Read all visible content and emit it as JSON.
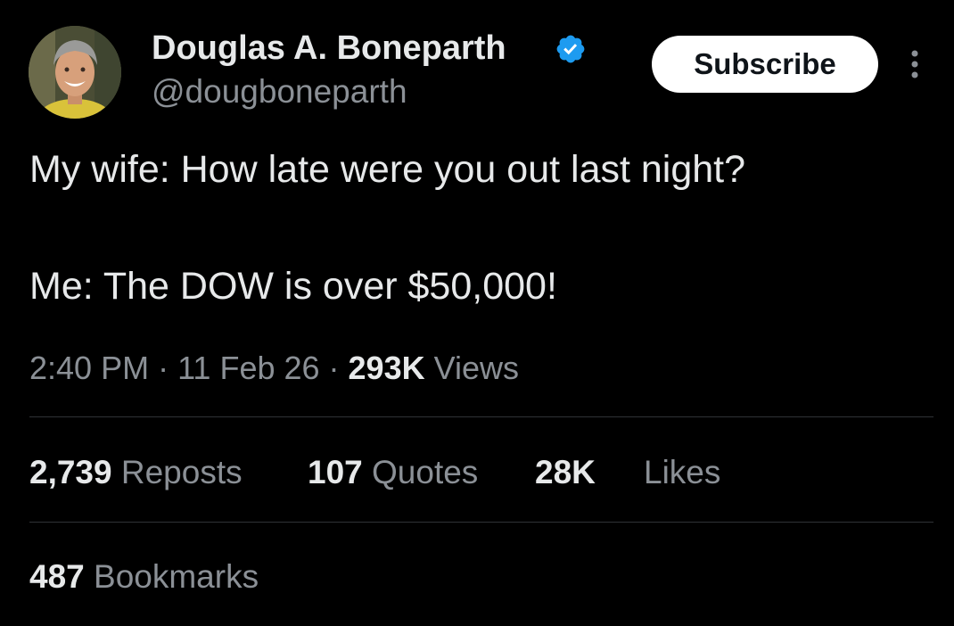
{
  "author": {
    "display_name": "Douglas A. Boneparth",
    "handle": "@dougboneparth",
    "verified_icon": "verified-badge-icon",
    "avatar_icon": "profile-photo"
  },
  "subscribe_label": "Subscribe",
  "more_icon": "more-vertical-icon",
  "tweet": {
    "line1": "My wife: How late were you out last night?",
    "line2": "Me: The DOW is over $50,000!"
  },
  "meta": {
    "time": "2:40 PM",
    "sep1": " · ",
    "date": "11 Feb 26",
    "sep2": " · ",
    "views_count": "293K",
    "views_label": " Views"
  },
  "stats": {
    "reposts_count": "2,739",
    "reposts_label": " Reposts",
    "quotes_count": "107",
    "quotes_label": " Quotes",
    "likes_count": "28K",
    "likes_label": "Likes",
    "bookmarks_count": "487",
    "bookmarks_label": " Bookmarks"
  },
  "colors": {
    "background": "#000000",
    "primary_text": "#e7e9ea",
    "secondary_text": "#8b9096",
    "verified_blue": "#1d9bf0",
    "divider": "#2f3336",
    "button_bg": "#ffffff"
  }
}
